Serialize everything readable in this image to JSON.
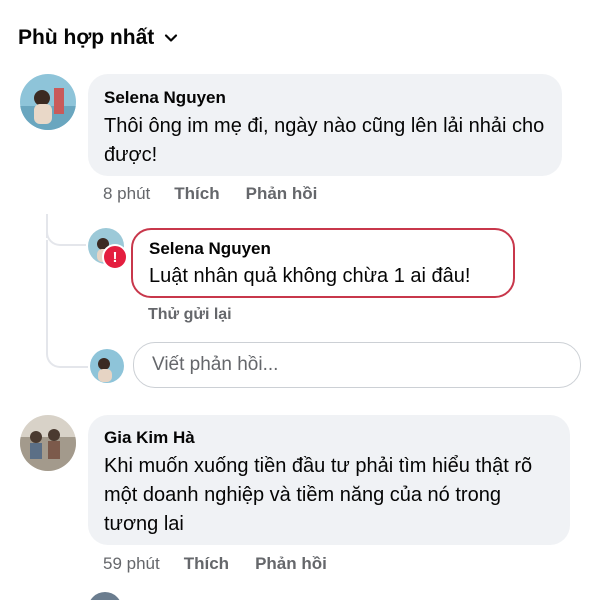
{
  "sort": {
    "label": "Phù hợp nhất",
    "chevron_icon": "chevron-down-icon"
  },
  "comments": [
    {
      "author": "Selena Nguyen",
      "text": "Thôi ông im mẹ đi, ngày nào cũng lên lải nhải cho được!",
      "time": "8 phút",
      "like_label": "Thích",
      "reply_label": "Phản hồi"
    },
    {
      "author": "Gia Kim Hà",
      "text": "Khi muốn xuống tiền đầu tư phải tìm hiểu thật rõ một doanh nghiệp và tiềm năng của nó trong tương lai",
      "time": "59 phút",
      "like_label": "Thích",
      "reply_label": "Phản hồi"
    }
  ],
  "failed_reply": {
    "author": "Selena Nguyen",
    "text": "Luật nhân quả không chừa 1 ai đâu!",
    "error_icon": "exclamation-icon",
    "retry_label": "Thử gửi lại"
  },
  "reply_box": {
    "placeholder": "Viết phản hồi..."
  },
  "colors": {
    "bubble_bg": "#f0f2f5",
    "error_red": "#e41e3f",
    "failed_border": "#c8374b",
    "muted_text": "#65676b"
  }
}
